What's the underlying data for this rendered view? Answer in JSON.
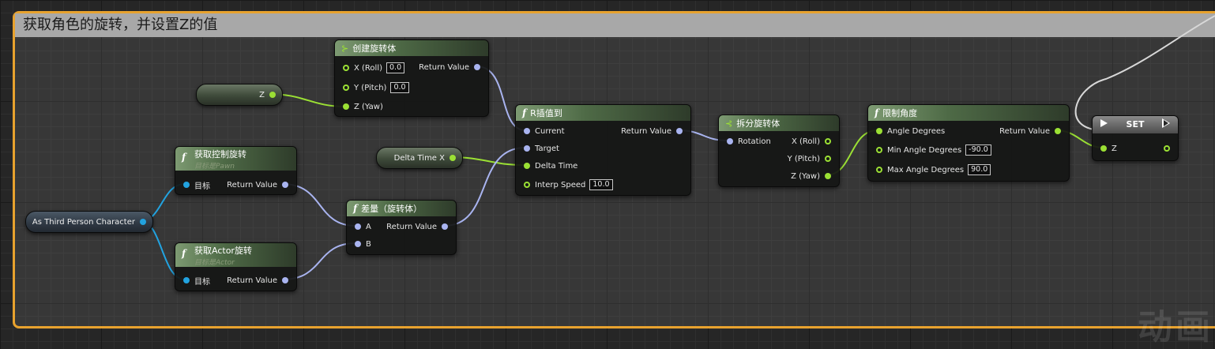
{
  "comment": {
    "title": "获取角色的旋转，并设置Z的值"
  },
  "colors": {
    "accent_border": "#e8a22e",
    "rotator_wire": "#a9b4f0",
    "float_wire": "#9be034",
    "object_wire": "#22a3e0"
  },
  "variables": {
    "z": "Z",
    "delta_time": "Delta Time X",
    "as_third_person": "As Third Person Character"
  },
  "make_rotator": {
    "title": "创建旋转体",
    "pins": {
      "x_label": "X (Roll)",
      "x_value": "0.0",
      "y_label": "Y (Pitch)",
      "y_value": "0.0",
      "z_label": "Z (Yaw)",
      "out": "Return Value"
    }
  },
  "get_control_rotation": {
    "title": "获取控制旋转",
    "subtitle": "目标是Pawn",
    "target": "目标",
    "out": "Return Value"
  },
  "get_actor_rotation": {
    "title": "获取Actor旋转",
    "subtitle": "目标是Actor",
    "target": "目标",
    "out": "Return Value"
  },
  "delta_rotator": {
    "title": "差量（旋转体）",
    "a": "A",
    "b": "B",
    "out": "Return Value"
  },
  "rinterp": {
    "title": "R插值到",
    "current": "Current",
    "target": "Target",
    "delta_time": "Delta Time",
    "interp_speed": "Interp Speed",
    "interp_value": "10.0",
    "out": "Return Value"
  },
  "break_rotator": {
    "title": "拆分旋转体",
    "in": "Rotation",
    "x": "X (Roll)",
    "y": "Y (Pitch)",
    "z": "Z (Yaw)"
  },
  "clamp_angle": {
    "title": "限制角度",
    "angle": "Angle Degrees",
    "min": "Min Angle Degrees",
    "min_value": "-90.0",
    "max": "Max Angle Degrees",
    "max_value": "90.0",
    "out": "Return Value"
  },
  "set_node": {
    "title": "SET",
    "pin": "Z"
  },
  "watermark": "动画"
}
